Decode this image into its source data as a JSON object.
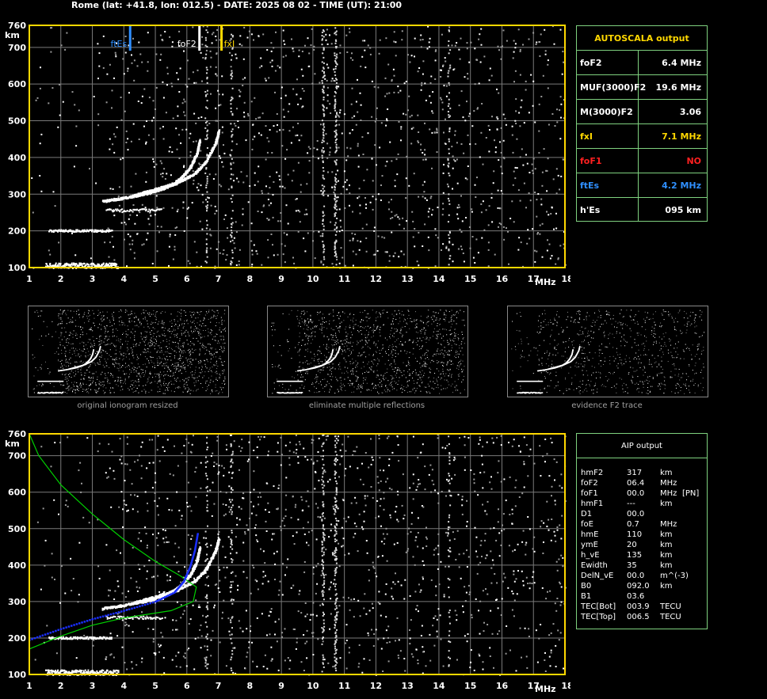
{
  "title": "Rome (lat: +41.8, lon: 012.5) - DATE: 2025 08 02 - TIME (UT): 21:00",
  "colors": {
    "grid": "#7a7a7a",
    "frame": "#ffd800",
    "table_border": "#7fd17f",
    "fxI": "#ffd800",
    "foF1": "#ff2020",
    "ftEs": "#2f8fff",
    "profile_true": "#00d000",
    "profile_aip": "#1a2fff"
  },
  "chart_data": [
    {
      "type": "scatter",
      "name_id": "ionogram-top",
      "x_unit": "MHz",
      "y_unit": "km",
      "xlim": [
        1,
        18
      ],
      "ylim": [
        100,
        760
      ],
      "x_ticks": [
        "1",
        "2",
        "3",
        "4",
        "5",
        "6",
        "7",
        "8",
        "9",
        "10",
        "11",
        "12",
        "13",
        "14",
        "15",
        "16",
        "17",
        "18"
      ],
      "y_ticks": [
        "100",
        "200",
        "300",
        "400",
        "500",
        "600",
        "700",
        "760"
      ],
      "markers": [
        {
          "label": "ftEs",
          "x": 4.2
        },
        {
          "label": "foF2",
          "x": 6.4
        },
        {
          "label": "fxI",
          "x": 7.1
        }
      ],
      "traces": {
        "es_layer_110": {
          "fmin": 1.5,
          "fmax": 3.8,
          "height": 105
        },
        "es_layer_200": {
          "fmin": 1.6,
          "fmax": 3.6,
          "height": 202
        },
        "o_trace": [
          [
            3.3,
            282
          ],
          [
            4.0,
            291
          ],
          [
            4.8,
            305
          ],
          [
            5.4,
            322
          ],
          [
            5.8,
            345
          ],
          [
            6.1,
            375
          ],
          [
            6.3,
            410
          ],
          [
            6.4,
            450
          ]
        ],
        "x_trace": [
          [
            4.2,
            295
          ],
          [
            4.8,
            310
          ],
          [
            5.6,
            330
          ],
          [
            6.2,
            355
          ],
          [
            6.6,
            390
          ],
          [
            6.9,
            440
          ],
          [
            7.0,
            475
          ]
        ]
      }
    },
    {
      "type": "scatter",
      "name_id": "ionogram-bottom",
      "x_unit": "MHz",
      "y_unit": "km",
      "xlim": [
        1,
        18
      ],
      "ylim": [
        100,
        760
      ],
      "x_ticks": [
        "1",
        "2",
        "3",
        "4",
        "5",
        "6",
        "7",
        "8",
        "9",
        "10",
        "11",
        "12",
        "13",
        "14",
        "15",
        "16",
        "17",
        "18"
      ],
      "y_ticks": [
        "100",
        "200",
        "300",
        "400",
        "500",
        "600",
        "700",
        "760"
      ],
      "profile_true": [
        [
          1.0,
          760
        ],
        [
          1.3,
          700
        ],
        [
          2.0,
          620
        ],
        [
          3.0,
          540
        ],
        [
          4.0,
          470
        ],
        [
          5.0,
          410
        ],
        [
          5.8,
          370
        ],
        [
          6.3,
          340
        ],
        [
          6.2,
          300
        ],
        [
          5.5,
          275
        ],
        [
          4.0,
          255
        ],
        [
          3.0,
          235
        ],
        [
          2.0,
          205
        ],
        [
          1.0,
          170
        ]
      ],
      "profile_aip": [
        [
          1.0,
          195
        ],
        [
          2.0,
          225
        ],
        [
          3.0,
          252
        ],
        [
          4.0,
          275
        ],
        [
          5.0,
          300
        ],
        [
          5.6,
          325
        ],
        [
          5.9,
          355
        ],
        [
          6.1,
          395
        ],
        [
          6.25,
          440
        ],
        [
          6.35,
          490
        ]
      ]
    }
  ],
  "autoscala": {
    "header": "AUTOSCALA output",
    "rows": [
      {
        "k": "foF2",
        "v": "6.4 MHz",
        "color": "#ffffff"
      },
      {
        "k": "MUF(3000)F2",
        "v": "19.6 MHz",
        "color": "#ffffff"
      },
      {
        "k": "M(3000)F2",
        "v": "3.06",
        "color": "#ffffff"
      },
      {
        "k": "fxI",
        "v": "7.1 MHz",
        "color": "#ffd800"
      },
      {
        "k": "foF1",
        "v": "NO",
        "color": "#ff2020"
      },
      {
        "k": "ftEs",
        "v": "4.2 MHz",
        "color": "#2f8fff"
      },
      {
        "k": "h'Es",
        "v": "095    km",
        "color": "#ffffff"
      }
    ]
  },
  "aip": {
    "header": "AIP output",
    "rows": [
      [
        "hmF2",
        "317",
        "km",
        ""
      ],
      [
        "foF2",
        "06.4",
        "MHz",
        ""
      ],
      [
        "foF1",
        "00.0",
        "MHz",
        "[PN]"
      ],
      [
        "hmF1",
        "---",
        "km",
        ""
      ],
      [
        "D1",
        "00.0",
        "",
        ""
      ],
      [
        "foE",
        "0.7",
        "MHz",
        ""
      ],
      [
        "hmE",
        "110",
        "km",
        ""
      ],
      [
        "ymE",
        "20",
        "km",
        ""
      ],
      [
        "h_vE",
        "135",
        "km",
        ""
      ],
      [
        "Ewidth",
        "35",
        "km",
        ""
      ],
      [
        "DelN_vE",
        "00.0",
        "m^(-3)",
        ""
      ],
      [
        "B0",
        "092.0",
        "km",
        ""
      ],
      [
        "B1",
        "03.6",
        "",
        ""
      ],
      [
        "TEC[Bot]",
        "003.9",
        "TECU",
        ""
      ],
      [
        "TEC[Top]",
        "006.5",
        "TECU",
        ""
      ]
    ]
  },
  "thumbnails": [
    {
      "caption": "original ionogram resized"
    },
    {
      "caption": "eliminate multiple reflections"
    },
    {
      "caption": "evidence F2 trace"
    }
  ]
}
